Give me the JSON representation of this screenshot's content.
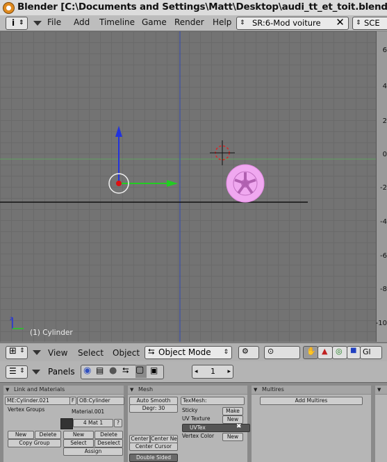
{
  "titlebar": {
    "title": "Blender [C:\\Documents and Settings\\Matt\\Desktop\\audi_tt_et_toit.blend]"
  },
  "menubar": {
    "info_label": "i",
    "items": [
      "File",
      "Add",
      "Timeline",
      "Game",
      "Render",
      "Help"
    ],
    "screen_selector": "SR:6-Mod voiture",
    "close_label": "✕",
    "scene_selector": "SCE"
  },
  "ruler": {
    "labels": [
      "6",
      "4",
      "2",
      "0",
      "-2",
      "-4",
      "-6",
      "-8",
      "-10"
    ]
  },
  "viewport": {
    "object_label": "(1) Cylinder"
  },
  "header3d": {
    "items": [
      "View",
      "Select",
      "Object"
    ],
    "mode": "Object Mode",
    "gl_label": "Gl"
  },
  "buttons_window": {
    "panels_label": "Panels",
    "frame": "1"
  },
  "link_materials": {
    "header": "Link and Materials",
    "me_field": "ME:Cylinder.021",
    "f_label": "F",
    "ob_field": "OB:Cylinder",
    "vertex_groups": "Vertex Groups",
    "material_name": "Material.001",
    "mat_index": "4 Mat 1",
    "question": "?",
    "new1": "New",
    "delete1": "Delete",
    "copy_group": "Copy Group",
    "new2": "New",
    "delete2": "Delete",
    "select": "Select",
    "deselect": "Deselect",
    "assign": "Assign"
  },
  "mesh": {
    "header": "Mesh",
    "auto_smooth": "Auto Smooth",
    "degr": "Degr: 30",
    "texmesh": "TexMesh:",
    "sticky": "Sticky",
    "make": "Make",
    "uv_texture": "UV Texture",
    "new_uv": "New",
    "uvtex": "UVTex",
    "vertex_color": "Vertex Color",
    "new_vc": "New",
    "center": "Center",
    "center_new": "Center Ne",
    "center_cursor": "Center Cursor",
    "double_sided": "Double Sided"
  },
  "multires": {
    "header": "Multires",
    "add_multires": "Add Multires"
  },
  "colors": {
    "viewport_bg": "#737373",
    "grid": "#6a6a6a",
    "z_axis": "#2233dd",
    "x_axis": "#22cc22",
    "origin_dot": "#dd1111",
    "selected_wheel": "#f0a8f0",
    "bottom_line": "#111111"
  }
}
